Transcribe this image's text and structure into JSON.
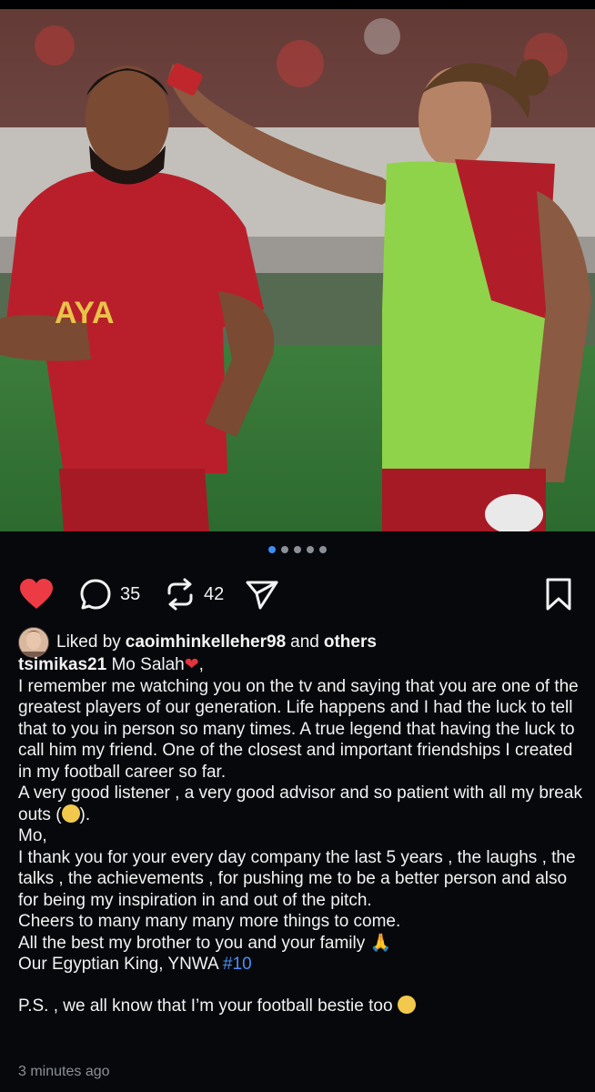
{
  "carousel": {
    "total": 5,
    "active_index": 0
  },
  "actions": {
    "like_icon": "heart-filled-icon",
    "comment_icon": "comment-icon",
    "comment_count": "35",
    "repost_icon": "repost-icon",
    "repost_count": "42",
    "share_icon": "send-icon",
    "save_icon": "bookmark-icon",
    "like_color": "#ed3b45"
  },
  "likes": {
    "prefix": "Liked by",
    "user": "caoimhinkelleher98",
    "joiner": "and",
    "others": "others"
  },
  "post": {
    "username": "tsimikas21",
    "first_line": "Mo Salah",
    "para1": "I remember me watching you on the tv and saying that you are one of the greatest players of our generation. Life happens and I had the luck to tell that to you in person so many times. A true legend that having the luck to call him my friend. One of the closest and important friendships I created in my football career so far.",
    "para2_a": "A very good listener , a very good advisor and so patient with all my break outs (",
    "para2_b": ").",
    "para3": "Mo,",
    "para4": "I thank you for your every day company the last 5 years , the laughs , the talks , the achievements , for pushing me to be a better person and also for being my inspiration in and out of the pitch.",
    "para5": "Cheers to many many many more things to come.",
    "para6": "All the best my brother to you and your family",
    "para7_a": "Our Egyptian King, YNWA",
    "hashtag": "#10",
    "ps": "P.S. , we all know that I’m your football bestie too",
    "timestamp": "3 minutes ago"
  }
}
